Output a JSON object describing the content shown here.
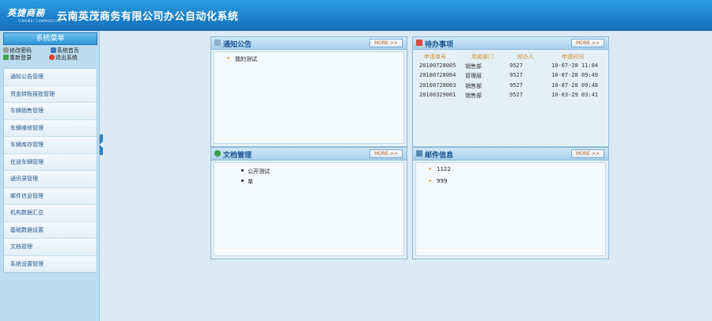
{
  "header": {
    "logo_cn": "英捷商務",
    "logo_en": "YINGMEI COMMERCIAL",
    "title": "云南英茂商务有限公司办公自动化系统"
  },
  "sidebar": {
    "title": "系统菜单",
    "quick_links": [
      {
        "label": "修改密码",
        "icon": "key-icon"
      },
      {
        "label": "系统首页",
        "icon": "home-icon"
      },
      {
        "label": "重新登录",
        "icon": "relogin-icon"
      },
      {
        "label": "退出系统",
        "icon": "exit-icon"
      }
    ],
    "items": [
      {
        "label": "通知公告管理"
      },
      {
        "label": "资金转账报批管理"
      },
      {
        "label": "车辆销售管理"
      },
      {
        "label": "车辆维修管理"
      },
      {
        "label": "车辆库存管理"
      },
      {
        "label": "在途车辆管理"
      },
      {
        "label": "通讯录管理"
      },
      {
        "label": "邮件信息管理"
      },
      {
        "label": "机构数据汇总"
      },
      {
        "label": "基础数据设置"
      },
      {
        "label": "文档管理"
      },
      {
        "label": "系统设置管理"
      }
    ]
  },
  "panels": {
    "notice": {
      "title": "通知公告",
      "more": "MORE >>",
      "items": [
        "我的测试"
      ]
    },
    "todo": {
      "title": "待办事项",
      "more": "MORE >>",
      "columns": [
        "申请单号",
        "用款部门",
        "经办人",
        "申请时间"
      ],
      "rows": [
        [
          "20100728005",
          "销售部",
          "9527",
          "10-07-28 11:04"
        ],
        [
          "20100728004",
          "管理层",
          "9527",
          "10-07-28 09:49"
        ],
        [
          "20100728003",
          "销售部",
          "9527",
          "10-07-28 09:48"
        ],
        [
          "20100329001",
          "销售部",
          "9527",
          "10-03-29 03:41"
        ]
      ]
    },
    "docs": {
      "title": "文档管理",
      "more": "MORE >>",
      "items": [
        "公开测试",
        "单"
      ]
    },
    "mail": {
      "title": "邮件信息",
      "more": "MORE >>",
      "items": [
        "1122",
        "999"
      ]
    }
  },
  "colors": {
    "header": "#1b7fc9",
    "accent": "#1c5490",
    "more_text": "#b35a1a",
    "table_header": "#d08a2a"
  }
}
